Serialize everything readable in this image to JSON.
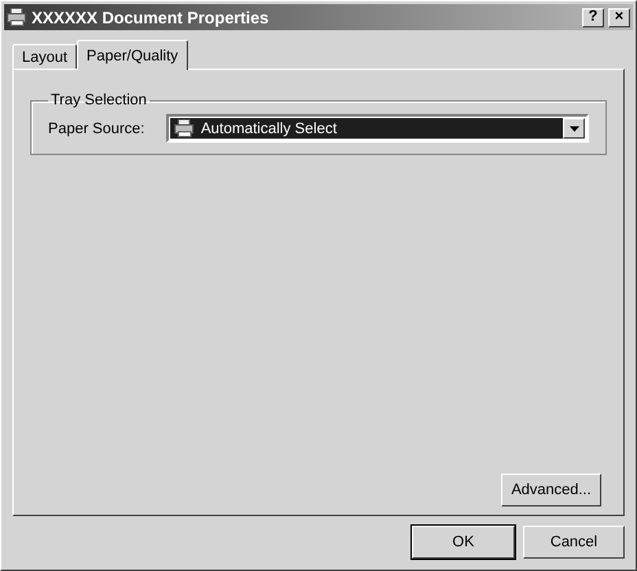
{
  "window": {
    "title": "XXXXXX Document Properties",
    "buttons": [
      "?",
      "×"
    ]
  },
  "tabs": [
    {
      "label": "Layout",
      "selected": false
    },
    {
      "label": "Paper/Quality",
      "selected": true
    }
  ],
  "tray_selection": {
    "title": "Tray Selection",
    "paper_source": {
      "label": "Paper Source:",
      "value": "Automatically Select",
      "selected": true
    }
  },
  "advanced_button": "Advanced...",
  "buttons": [
    {
      "label": "OK",
      "default": true
    },
    {
      "label": "Cancel",
      "default": false
    }
  ]
}
